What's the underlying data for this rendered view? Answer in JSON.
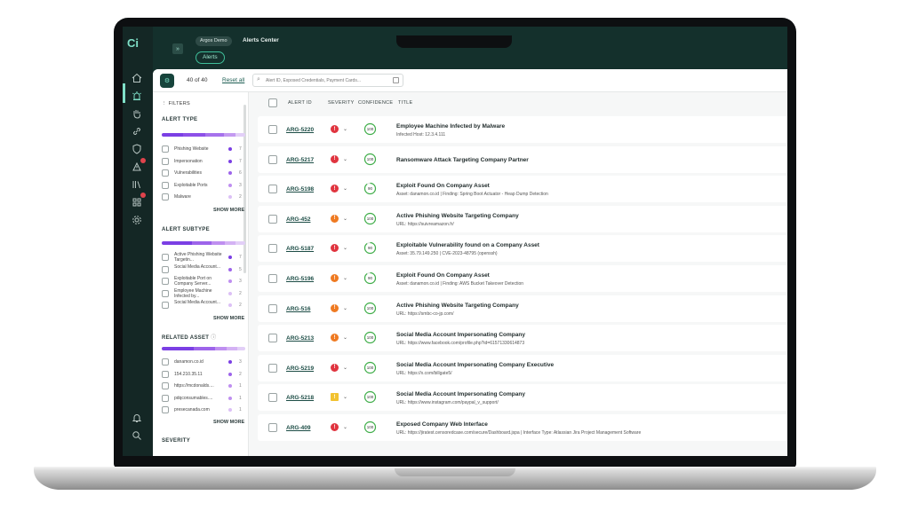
{
  "app": {
    "logo": "Ci",
    "workspace": "Argos Demo",
    "page": "Alerts Center",
    "active_tab": "Alerts"
  },
  "toolbar": {
    "count": "40 of 40",
    "reset": "Reset all",
    "search_placeholder": "Alert ID, Exposed Credentials, Payment Cards..."
  },
  "filters": {
    "title": "FILTERS",
    "alert_type": {
      "title": "ALERT TYPE",
      "items": [
        {
          "label": "Phishing Website",
          "count": "7",
          "color": "#7b3fe4"
        },
        {
          "label": "Impersonation",
          "count": "7",
          "color": "#7b3fe4"
        },
        {
          "label": "Vulnerabilities",
          "count": "6",
          "color": "#9d64ea"
        },
        {
          "label": "Exploitable Ports",
          "count": "3",
          "color": "#bf8ff0"
        },
        {
          "label": "Malware",
          "count": "2",
          "color": "#dcc0f6"
        }
      ],
      "show_more": "SHOW MORE"
    },
    "alert_subtype": {
      "title": "ALERT SUBTYPE",
      "items": [
        {
          "label": "Active Phishing Website Targetin...",
          "count": "7",
          "color": "#7b3fe4"
        },
        {
          "label": "Social Media Account...",
          "count": "5",
          "color": "#9d64ea"
        },
        {
          "label": "Exploitable Port on Company Server...",
          "count": "3",
          "color": "#bf8ff0"
        },
        {
          "label": "Employee Machine Infected by...",
          "count": "2",
          "color": "#dcc0f6"
        },
        {
          "label": "Social Media Account...",
          "count": "2",
          "color": "#dcc0f6"
        }
      ],
      "show_more": "SHOW MORE"
    },
    "related_asset": {
      "title": "RELATED ASSET",
      "items": [
        {
          "label": "danamon.co.id",
          "count": "3",
          "color": "#7b3fe4"
        },
        {
          "label": "154.210.35.11",
          "count": "2",
          "color": "#9d64ea"
        },
        {
          "label": "https://mcdonalds....",
          "count": "1",
          "color": "#bf8ff0"
        },
        {
          "label": "pdqconsumables....",
          "count": "1",
          "color": "#bf8ff0"
        },
        {
          "label": "presecanada.com",
          "count": "1",
          "color": "#dcc0f6"
        }
      ],
      "show_more": "SHOW MORE"
    },
    "severity": {
      "title": "SEVERITY"
    }
  },
  "table": {
    "headers": {
      "alert_id": "ALERT ID",
      "severity": "SEVERITY",
      "confidence": "CONFIDENCE",
      "title": "TITLE"
    },
    "rows": [
      {
        "id": "ARG-5220",
        "severity": "critical",
        "confidence": "100",
        "title": "Employee Machine Infected by Malware",
        "sub": "Infected Host: 12.3.4.111"
      },
      {
        "id": "ARG-5217",
        "severity": "critical",
        "confidence": "100",
        "title": "Ransomware Attack Targeting Company Partner",
        "sub": ""
      },
      {
        "id": "ARG-5198",
        "severity": "critical",
        "confidence": "90",
        "title": "Exploit Found On Company Asset",
        "sub": "Asset: danamon.co.id | Finding: Spring Boot Actuator - Heap Dump Detection"
      },
      {
        "id": "ARG-452",
        "severity": "high",
        "confidence": "100",
        "title": "Active Phishing Website Targeting Company",
        "sub": "URL: https://suivreamazon.fr/"
      },
      {
        "id": "ARG-5187",
        "severity": "critical",
        "confidence": "90",
        "title": "Exploitable Vulnerability found on a Company Asset",
        "sub": "Asset: 35.79.149.250 | CVE-2023-48795 (openssh)"
      },
      {
        "id": "ARG-5196",
        "severity": "high",
        "confidence": "90",
        "title": "Exploit Found On Company Asset",
        "sub": "Asset: danamon.co.id | Finding: AWS Bucket Takeover Detection"
      },
      {
        "id": "ARG-516",
        "severity": "high",
        "confidence": "100",
        "title": "Active Phishing Website Targeting Company",
        "sub": "URL: https://smbc-co-jp.com/"
      },
      {
        "id": "ARG-5213",
        "severity": "high",
        "confidence": "100",
        "title": "Social Media Account Impersonating Company",
        "sub": "URL: https://www.facebook.com/profile.php?id=61571330614873"
      },
      {
        "id": "ARG-5219",
        "severity": "critical",
        "confidence": "100",
        "title": "Social Media Account Impersonating Company Executive",
        "sub": "URL: https://x.com/billgate5/"
      },
      {
        "id": "ARG-5218",
        "severity": "medium",
        "confidence": "100",
        "title": "Social Media Account Impersonating Company",
        "sub": "URL: https://www.instagram.com/paypal_v_support/"
      },
      {
        "id": "ARG-409",
        "severity": "critical",
        "confidence": "100",
        "title": "Exposed Company Web Interface",
        "sub": "URL: https://jiratest.censoredcase.com/secure/Dashboard.jspa | Interface Type: Atlassian Jira Project Management Software"
      }
    ]
  },
  "colors": {
    "critical": "#e0343f",
    "high": "#ef7a22",
    "medium": "#f2c230",
    "confidence_ring": "#3fae49"
  }
}
